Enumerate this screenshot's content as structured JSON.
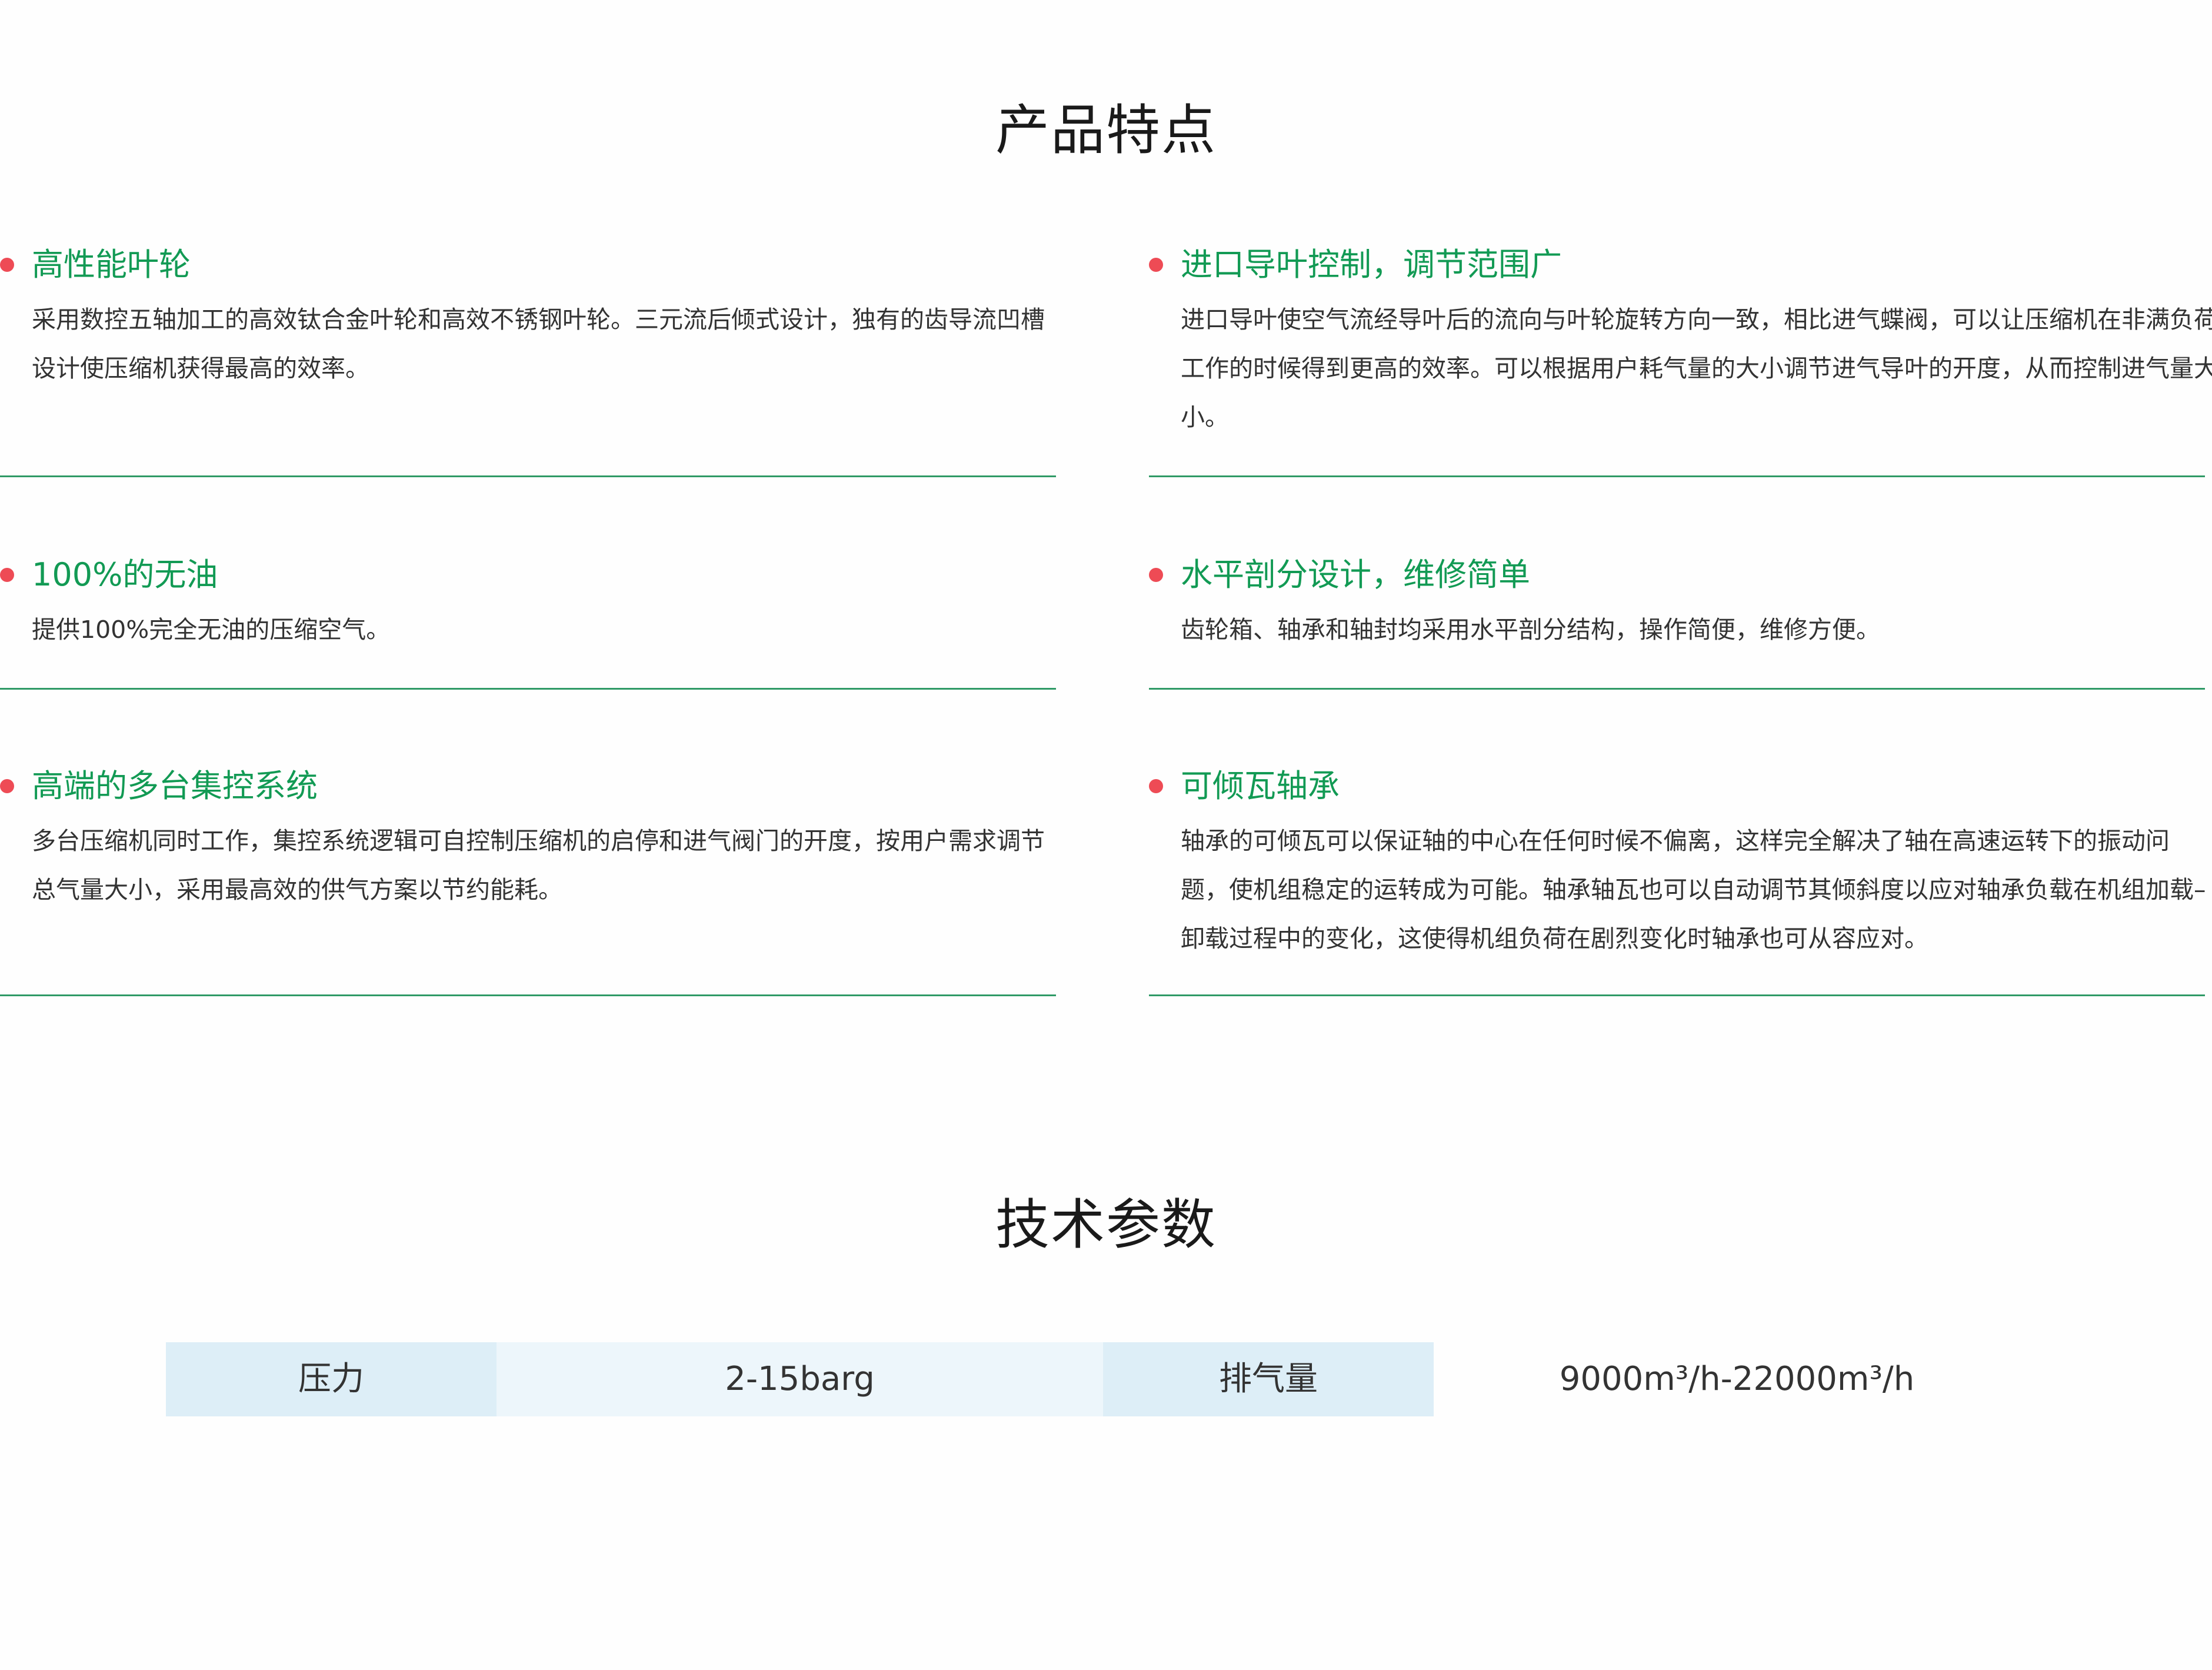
{
  "features_section": {
    "title": "产品特点",
    "items": [
      {
        "title": "高性能叶轮",
        "description": "采用数控五轴加工的高效钛合金叶轮和高效不锈钢叶轮。三元流后倾式设计，独有的齿导流凹槽设计使压缩机获得最高的效率。"
      },
      {
        "title": "进口导叶控制，调节范围广",
        "description": "进口导叶使空气流经导叶后的流向与叶轮旋转方向一致，相比进气蝶阀，可以让压缩机在非满负荷工作的时候得到更高的效率。可以根据用户耗气量的大小调节进气导叶的开度，从而控制进气量大小。"
      },
      {
        "title": "100%的无油",
        "description": "提供100%完全无油的压缩空气。"
      },
      {
        "title": "水平剖分设计，维修简单",
        "description": "齿轮箱、轴承和轴封均采用水平剖分结构，操作简便，维修方便。"
      },
      {
        "title": "高端的多台集控系统",
        "description": "多台压缩机同时工作，集控系统逻辑可自控制压缩机的启停和进气阀门的开度，按用户需求调节总气量大小，采用最高效的供气方案以节约能耗。"
      },
      {
        "title": "可倾瓦轴承",
        "description": "轴承的可倾瓦可以保证轴的中心在任何时候不偏离，这样完全解决了轴在高速运转下的振动问题，使机组稳定的运转成为可能。轴承轴瓦也可以自动调节其倾斜度以应对轴承负载在机组加载–卸载过程中的变化，这使得机组负荷在剧烈变化时轴承也可从容应对。"
      }
    ]
  },
  "specs_section": {
    "title": "技术参数",
    "rows": [
      {
        "label_1": "压力",
        "value_1": "2-15barg",
        "label_2": "排气量",
        "value_2": "9000m³/h-22000m³/h"
      }
    ]
  },
  "colors": {
    "accent_green": "#129a54",
    "bullet_red": "#ee4b55",
    "divider_green": "#2f9a66",
    "spec_label_bg": "#ddeef7",
    "spec_value_bg": "#edf6fb"
  }
}
